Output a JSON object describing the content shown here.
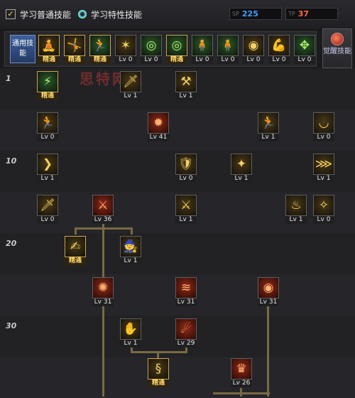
{
  "header": {
    "tab_common": "学习普通技能",
    "tab_trait": "学习特性技能",
    "sp_label": "SP",
    "sp_value": "225",
    "tp_label": "TP",
    "tp_value": "37",
    "sp_color": "#3fa0ff",
    "tp_color": "#ff6a3a"
  },
  "toolbar": {
    "common_label": "通用技能",
    "awaken_label": "觉醒技能",
    "skills": [
      {
        "lv": "精通",
        "icon": "🧘",
        "tint": "gold"
      },
      {
        "lv": "精通",
        "icon": "🤸",
        "tint": "gold"
      },
      {
        "lv": "精通",
        "icon": "🏃",
        "tint": "green"
      },
      {
        "lv": "Lv 0",
        "icon": "✶",
        "tint": "gold"
      },
      {
        "lv": "Lv 0",
        "icon": "◎",
        "tint": "green"
      },
      {
        "lv": "精通",
        "icon": "◎",
        "tint": "green"
      },
      {
        "lv": "Lv 0",
        "icon": "🧍",
        "tint": "green"
      },
      {
        "lv": "Lv 0",
        "icon": "🧍",
        "tint": "green"
      },
      {
        "lv": "Lv 0",
        "icon": "◉",
        "tint": "gold"
      },
      {
        "lv": "Lv 0",
        "icon": "💪",
        "tint": "gold"
      },
      {
        "lv": "Lv 0",
        "icon": "✥",
        "tint": "green"
      }
    ]
  },
  "watermark": "思特网",
  "row_levels": [
    "1",
    "10",
    "20",
    "30"
  ],
  "tree": [
    {
      "lv": "精通",
      "icon": "⚡",
      "tint": "green",
      "m": true
    },
    {
      "lv": "Lv 1",
      "icon": "🗡",
      "tint": "gold"
    },
    {
      "lv": "Lv 1",
      "icon": "⚒",
      "tint": "gold"
    },
    {
      "lv": "Lv 0",
      "icon": "🏃",
      "tint": "gold"
    },
    {
      "lv": "Lv 41",
      "icon": "✹",
      "tint": "red"
    },
    {
      "lv": "Lv 1",
      "icon": "🏃",
      "tint": "gold"
    },
    {
      "lv": "Lv 0",
      "icon": "◡",
      "tint": "gold"
    },
    {
      "lv": "Lv 1",
      "icon": "❯",
      "tint": "gold"
    },
    {
      "lv": "Lv 0",
      "icon": "🛡",
      "tint": "gold"
    },
    {
      "lv": "Lv 1",
      "icon": "✦",
      "tint": "gold"
    },
    {
      "lv": "Lv 1",
      "icon": "⋙",
      "tint": "gold"
    },
    {
      "lv": "Lv 0",
      "icon": "🗡",
      "tint": "gold"
    },
    {
      "lv": "Lv 36",
      "icon": "⚔",
      "tint": "red"
    },
    {
      "lv": "Lv 1",
      "icon": "⚔",
      "tint": "gold"
    },
    {
      "lv": "Lv 1",
      "icon": "♨",
      "tint": "gold"
    },
    {
      "lv": "Lv 0",
      "icon": "✧",
      "tint": "gold"
    },
    {
      "lv": "精通",
      "icon": "✍",
      "tint": "gold",
      "m": true
    },
    {
      "lv": "Lv 1",
      "icon": "🧙",
      "tint": "gold"
    },
    {
      "lv": "Lv 31",
      "icon": "✺",
      "tint": "red"
    },
    {
      "lv": "Lv 31",
      "icon": "≋",
      "tint": "red"
    },
    {
      "lv": "Lv 31",
      "icon": "◉",
      "tint": "red"
    },
    {
      "lv": "Lv 1",
      "icon": "✋",
      "tint": "gold"
    },
    {
      "lv": "Lv 29",
      "icon": "☄",
      "tint": "red"
    },
    {
      "lv": "精通",
      "icon": "§",
      "tint": "gold",
      "m": true
    },
    {
      "lv": "Lv 26",
      "icon": "♛",
      "tint": "red"
    }
  ]
}
